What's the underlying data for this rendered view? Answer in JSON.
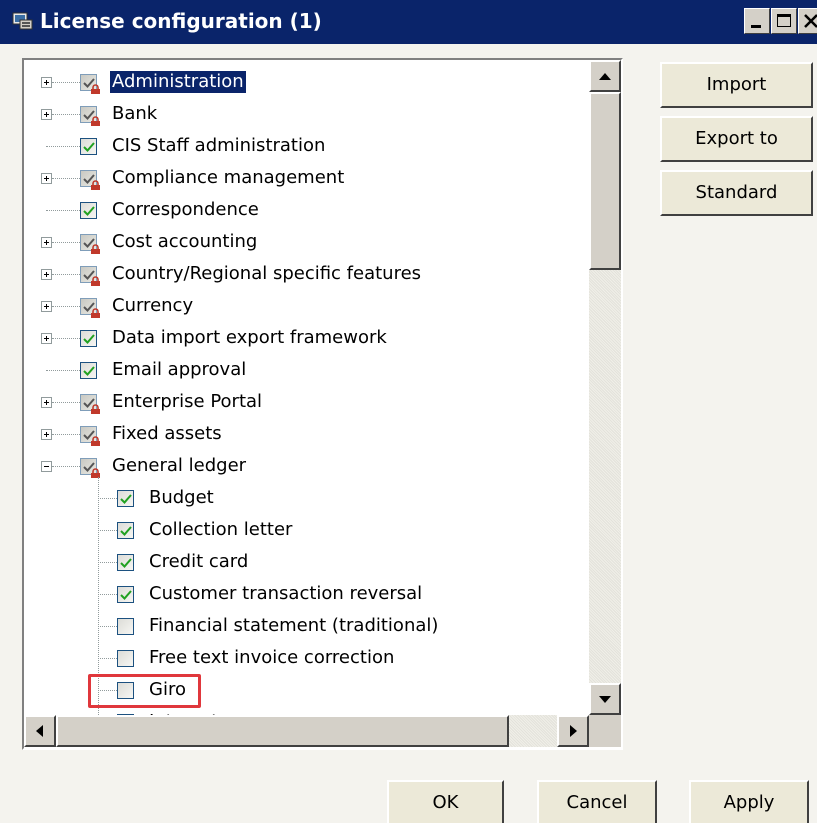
{
  "window": {
    "title": "License configuration (1)"
  },
  "tree": {
    "items": [
      {
        "label": "Administration",
        "level": 0,
        "expander": "plus",
        "locked": true,
        "checked": true,
        "selected": true
      },
      {
        "label": "Bank",
        "level": 0,
        "expander": "plus",
        "locked": true,
        "checked": true
      },
      {
        "label": "CIS Staff administration",
        "level": 0,
        "expander": "none",
        "locked": false,
        "checked": true
      },
      {
        "label": "Compliance management",
        "level": 0,
        "expander": "plus",
        "locked": true,
        "checked": true
      },
      {
        "label": "Correspondence",
        "level": 0,
        "expander": "none",
        "locked": false,
        "checked": true
      },
      {
        "label": "Cost accounting",
        "level": 0,
        "expander": "plus",
        "locked": true,
        "checked": true
      },
      {
        "label": "Country/Regional specific features",
        "level": 0,
        "expander": "plus",
        "locked": true,
        "checked": true
      },
      {
        "label": "Currency",
        "level": 0,
        "expander": "plus",
        "locked": true,
        "checked": true
      },
      {
        "label": "Data import export framework",
        "level": 0,
        "expander": "plus",
        "locked": false,
        "checked": true
      },
      {
        "label": "Email approval",
        "level": 0,
        "expander": "none",
        "locked": false,
        "checked": true
      },
      {
        "label": "Enterprise Portal",
        "level": 0,
        "expander": "plus",
        "locked": true,
        "checked": true
      },
      {
        "label": "Fixed assets",
        "level": 0,
        "expander": "plus",
        "locked": true,
        "checked": true
      },
      {
        "label": "General ledger",
        "level": 0,
        "expander": "minus",
        "locked": true,
        "checked": true
      },
      {
        "label": "Budget",
        "level": 1,
        "expander": "none",
        "locked": false,
        "checked": true
      },
      {
        "label": "Collection letter",
        "level": 1,
        "expander": "none",
        "locked": false,
        "checked": true
      },
      {
        "label": "Credit card",
        "level": 1,
        "expander": "none",
        "locked": false,
        "checked": true
      },
      {
        "label": "Customer transaction reversal",
        "level": 1,
        "expander": "none",
        "locked": false,
        "checked": true
      },
      {
        "label": "Financial statement (traditional)",
        "level": 1,
        "expander": "none",
        "locked": false,
        "checked": false
      },
      {
        "label": "Free text invoice correction",
        "level": 1,
        "expander": "none",
        "locked": false,
        "checked": false
      },
      {
        "label": "Giro",
        "level": 1,
        "expander": "none",
        "locked": false,
        "checked": false,
        "highlighted": true
      },
      {
        "label": "Interest",
        "level": 1,
        "expander": "none",
        "locked": false,
        "checked": true
      }
    ]
  },
  "side_buttons": {
    "import": "Import",
    "export": "Export to",
    "standard": "Standard"
  },
  "footer_buttons": {
    "ok": "OK",
    "cancel": "Cancel",
    "apply": "Apply"
  },
  "colors": {
    "title_bg": "#0a246a",
    "selection": "#0a246a",
    "highlight": "#e0373c",
    "lock": "#c0392b"
  }
}
